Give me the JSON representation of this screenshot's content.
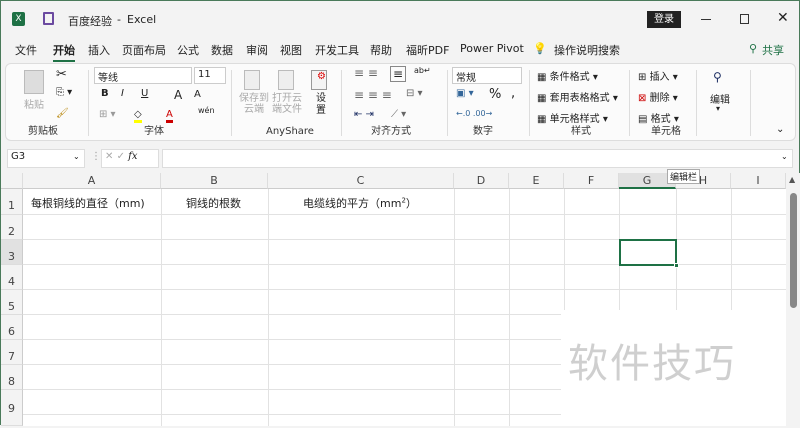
{
  "titlebar": {
    "app_icon": "X",
    "doc_title": "百度经验",
    "separator": "-",
    "app_name": "Excel",
    "login": "登录"
  },
  "tabs": [
    "文件",
    "开始",
    "插入",
    "页面布局",
    "公式",
    "数据",
    "审阅",
    "视图",
    "开发工具",
    "帮助",
    "福昕PDF",
    "Power Pivot"
  ],
  "tell_me": "操作说明搜索",
  "share": "共享",
  "ribbon": {
    "clipboard": {
      "paste": "粘贴",
      "label": "剪贴板"
    },
    "font": {
      "name": "等线",
      "size": "11",
      "bold": "B",
      "italic": "I",
      "underline": "U",
      "grow": "A",
      "shrink": "A",
      "label": "字体",
      "wen": "wén"
    },
    "anyshare": {
      "save": "保存到云端",
      "open": "打开云端文件",
      "settings": "设置",
      "label": "AnyShare"
    },
    "alignment": {
      "label": "对齐方式"
    },
    "number": {
      "format": "常规",
      "percent": "%",
      "comma": ",",
      "label": "数字"
    },
    "styles": {
      "conditional": "条件格式",
      "table": "套用表格格式",
      "cell": "单元格样式",
      "label": "样式"
    },
    "cells": {
      "insert": "插入",
      "delete": "删除",
      "format": "格式",
      "label": "单元格"
    },
    "editing": {
      "label": "编辑"
    }
  },
  "formula_bar": {
    "name_box": "G3",
    "fx": "fx",
    "value": "",
    "tooltip": "编辑栏"
  },
  "columns": [
    "A",
    "B",
    "C",
    "D",
    "E",
    "F",
    "G",
    "H",
    "I"
  ],
  "rows": [
    "1",
    "2",
    "3",
    "4",
    "5",
    "6",
    "7",
    "8",
    "9"
  ],
  "cells": {
    "A1": "每根铜线的直径（mm)",
    "B1": "铜线的根数",
    "C1": "电缆线的平方（mm",
    "C1_sup": "2",
    "C1_end": "）"
  },
  "watermark": "软件技巧"
}
